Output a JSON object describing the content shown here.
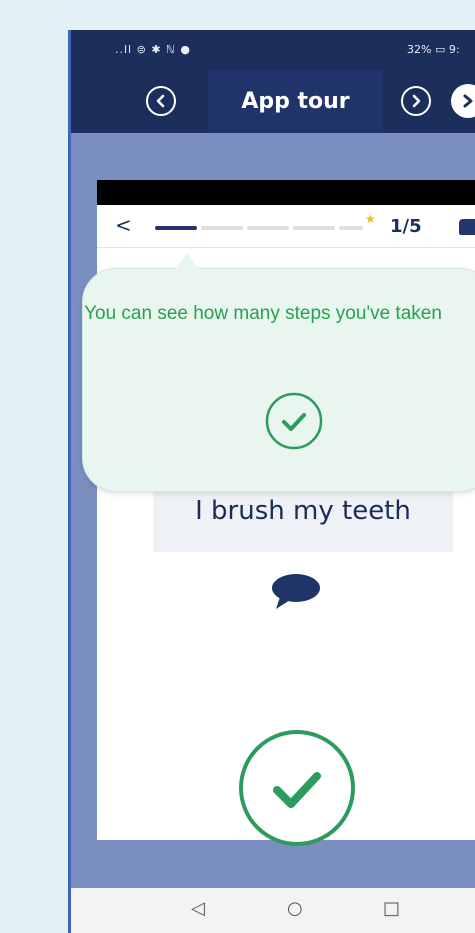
{
  "status_bar": {
    "left_icons": "..ll ⊜ ✱ ℕ ●",
    "right_text": "32% ▭ 9:"
  },
  "header": {
    "title": "App tour",
    "prev_icon": "chevron-left-icon",
    "next_icon": "chevron-right-icon",
    "close_icon": "close-icon"
  },
  "progress": {
    "back_label": "<",
    "step_text": "1/5",
    "current_step": 1,
    "total_steps": 5
  },
  "task": {
    "label": "I brush my teeth"
  },
  "tooltip": {
    "message": "You can see how many steps you've taken"
  },
  "nav": {
    "back": "◁",
    "home": "○",
    "recent": "□"
  },
  "colors": {
    "header_bg": "#1c2e5c",
    "backdrop": "#7a8fc0",
    "tooltip_bg": "#e8f6ef",
    "tooltip_text": "#27a04f",
    "check_green": "#2e9b5e"
  }
}
